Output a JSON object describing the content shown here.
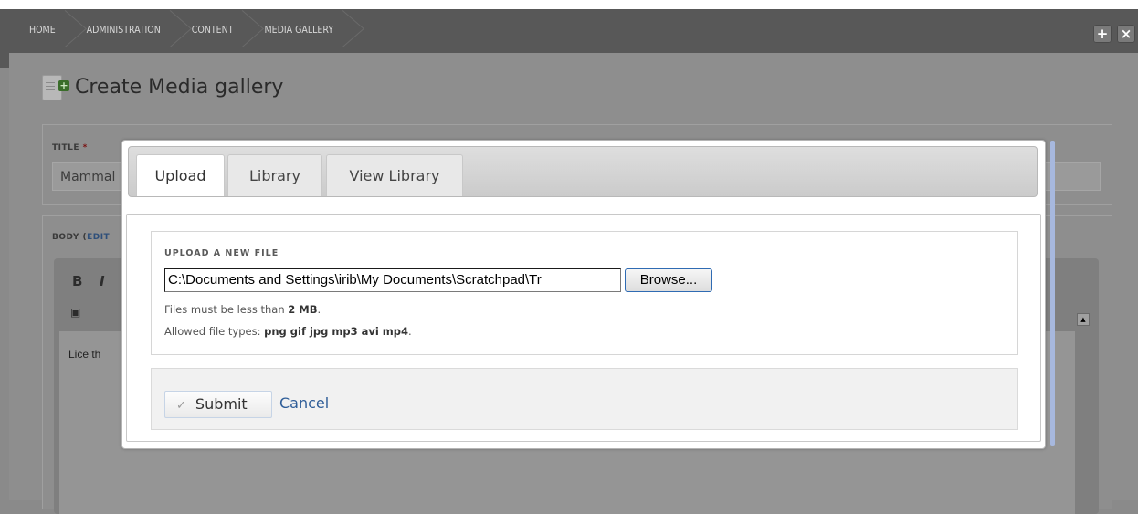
{
  "breadcrumb": [
    "HOME",
    "ADMINISTRATION",
    "CONTENT",
    "MEDIA GALLERY"
  ],
  "toolbar_buttons": {
    "add": "+",
    "close": "×"
  },
  "page": {
    "title": "Create Media gallery",
    "title_field": {
      "label": "TITLE",
      "required_mark": "*",
      "value": "Mammal"
    },
    "body_field": {
      "label": "BODY",
      "edit_link": "EDIT",
      "text": "Lice th"
    },
    "editor_buttons": {
      "bold": "B",
      "italic": "I"
    }
  },
  "dialog": {
    "tabs": [
      "Upload",
      "Library",
      "View Library"
    ],
    "active_tab": "Upload",
    "upload": {
      "section_label": "UPLOAD A NEW FILE",
      "file_path": "C:\\Documents and Settings\\irib\\My Documents\\Scratchpad\\Tr",
      "browse_label": "Browse...",
      "size_hint_prefix": "Files must be less than",
      "size_limit": "2 MB",
      "size_hint_suffix": ".",
      "types_hint_prefix": "Allowed file types:",
      "types": "png gif jpg mp3 avi mp4",
      "types_hint_suffix": "."
    },
    "actions": {
      "submit": "Submit",
      "cancel": "Cancel",
      "submit_check": "✓"
    }
  },
  "colors": {
    "toolbar": "#585858",
    "link": "#2e5d98",
    "browse_border": "#2f6bb3"
  }
}
